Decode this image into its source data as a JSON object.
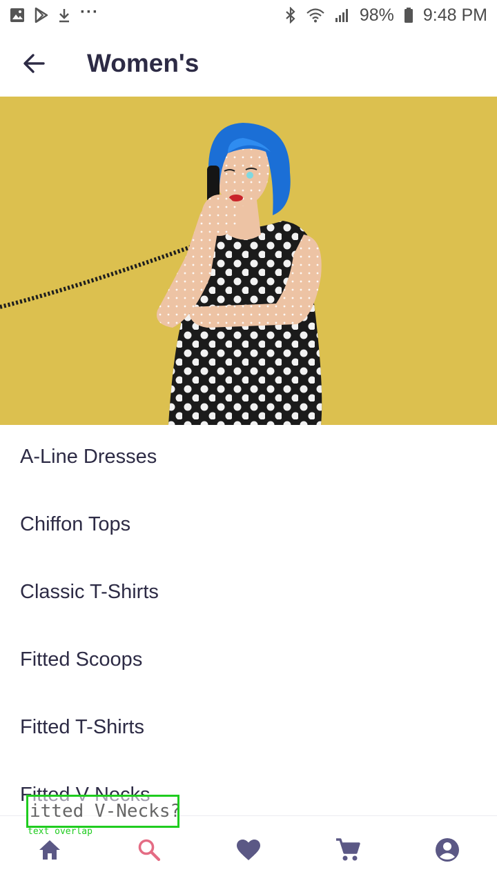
{
  "status_bar": {
    "battery": "98%",
    "time": "9:48 PM",
    "left_icons": [
      "image-icon",
      "play-store-icon",
      "download-icon",
      "more-icon"
    ],
    "right_icons": [
      "bluetooth-icon",
      "wifi-icon",
      "signal-icon",
      "battery-icon"
    ]
  },
  "header": {
    "title": "Women's",
    "back_icon": "arrow-left-icon"
  },
  "categories": [
    {
      "label": "A-Line Dresses"
    },
    {
      "label": "Chiffon Tops"
    },
    {
      "label": "Classic T-Shirts"
    },
    {
      "label": "Fitted Scoops"
    },
    {
      "label": "Fitted T-Shirts"
    },
    {
      "label": "Fitted V-Necks"
    }
  ],
  "bottom_nav": [
    {
      "name": "home",
      "icon": "home-icon",
      "active": false
    },
    {
      "name": "search",
      "icon": "search-icon",
      "active": true
    },
    {
      "name": "favorites",
      "icon": "heart-icon",
      "active": false
    },
    {
      "name": "cart",
      "icon": "cart-icon",
      "active": false
    },
    {
      "name": "account",
      "icon": "account-icon",
      "active": false
    }
  ],
  "overlay": {
    "text": "itted V-Necks?",
    "label": "text overlap"
  },
  "colors": {
    "primary": "#2d2b45",
    "nav_icon": "#5b5885",
    "active": "#e46c84",
    "hero_bg": "#dcc04f",
    "annotation": "#1fcc1f"
  }
}
